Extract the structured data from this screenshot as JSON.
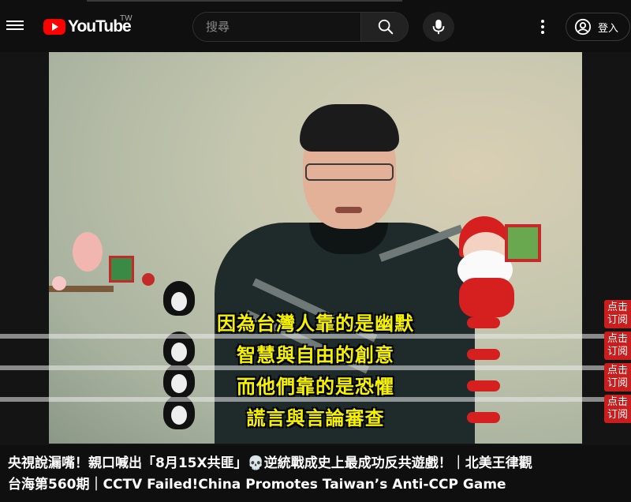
{
  "header": {
    "logo_text": "YouTube",
    "country_code": "TW",
    "search_placeholder": "搜尋",
    "signin_label": "登入"
  },
  "video": {
    "subtitles": [
      "因為台灣人靠的是幽默",
      "智慧與自由的創意",
      "而他們靠的是恐懼",
      "謊言與言論審查"
    ],
    "subscribe_badge": "点击\n订阅"
  },
  "title": {
    "line1": "央視說漏嘴！親口喊出「8月15X共匪」💀逆統戰成史上最成功反共遊戲！｜北美王律觀",
    "line2": "台海第560期｜CCTV Failed!China Promotes Taiwan’s Anti-CCP Game"
  },
  "colors": {
    "background": "#0f0f0f",
    "brand_red": "#ff0000",
    "subtitle_yellow": "#f7f200",
    "badge_red": "#c81e1e"
  },
  "icons": [
    "menu-icon",
    "youtube-logo-icon",
    "search-icon",
    "mic-icon",
    "more-vert-icon",
    "account-icon"
  ]
}
